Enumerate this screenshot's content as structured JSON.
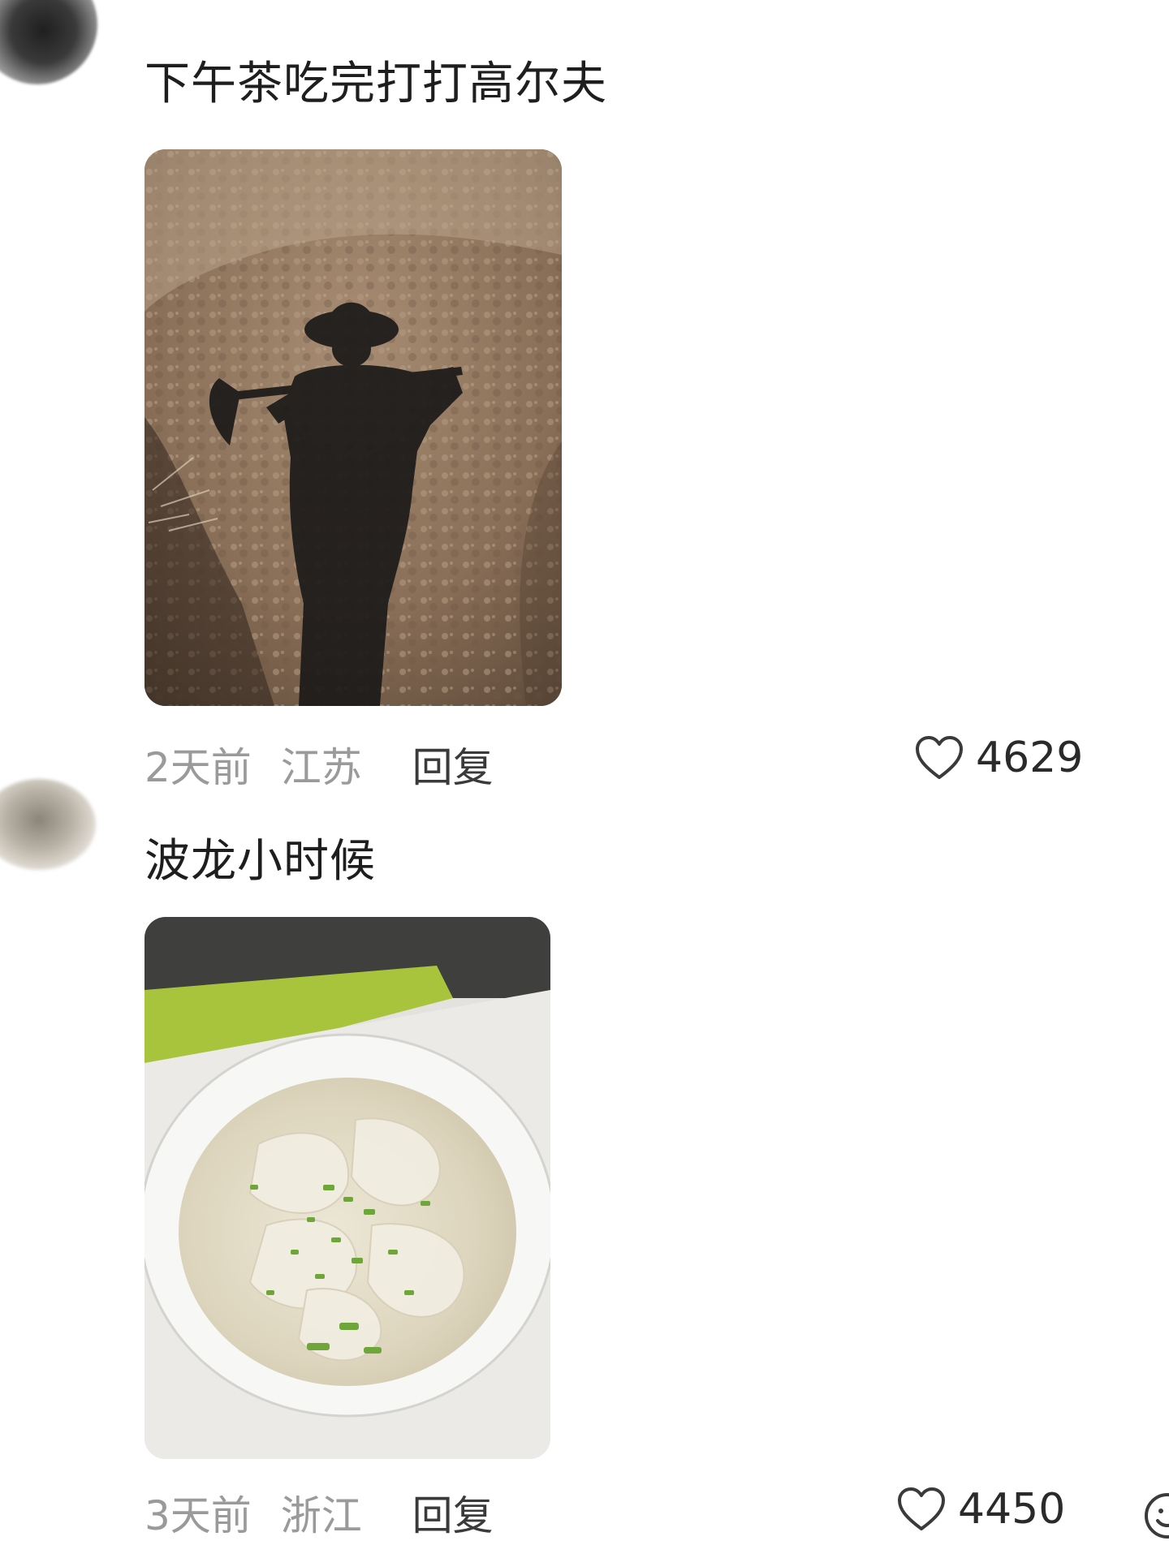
{
  "comments": [
    {
      "text": "下午茶吃完打打高尔夫",
      "time": "2天前",
      "location": "江苏",
      "reply_label": "回复",
      "likes": "4629",
      "image": "shadow-of-farmer-with-hoe-on-soil"
    },
    {
      "text": "波龙小时候",
      "time": "3天前",
      "location": "浙江",
      "reply_label": "回复",
      "likes": "4450",
      "image": "wonton-soup-bowl"
    }
  ],
  "icons": {
    "like": "heart-icon",
    "extra": "emoji-icon"
  }
}
